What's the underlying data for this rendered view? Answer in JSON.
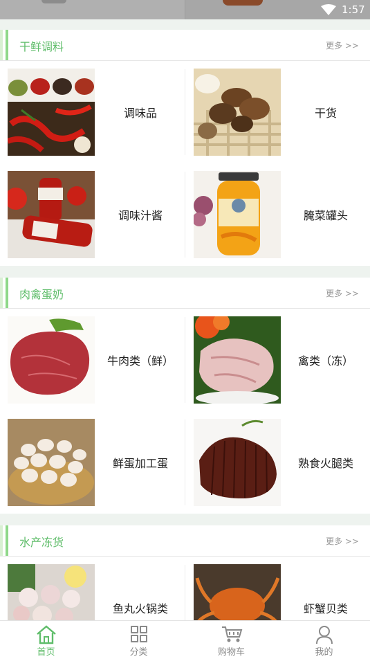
{
  "status": {
    "time": "1:57"
  },
  "sections": [
    {
      "title": "干鲜调料",
      "more": "更多 >>",
      "items": [
        {
          "label": "调味品"
        },
        {
          "label": "干货"
        },
        {
          "label": "调味汁酱"
        },
        {
          "label": "腌菜罐头"
        }
      ]
    },
    {
      "title": "肉禽蛋奶",
      "more": "更多 >>",
      "items": [
        {
          "label": "牛肉类（鲜）"
        },
        {
          "label": "禽类（冻）"
        },
        {
          "label": "鲜蛋加工蛋"
        },
        {
          "label": "熟食火腿类"
        }
      ]
    },
    {
      "title": "水产冻货",
      "more": "更多 >>",
      "items": [
        {
          "label": "鱼丸火锅类"
        },
        {
          "label": "虾蟹贝类"
        }
      ]
    }
  ],
  "tabs": [
    {
      "label": "首页",
      "icon": "home-icon",
      "active": true
    },
    {
      "label": "分类",
      "icon": "grid-icon"
    },
    {
      "label": "购物车",
      "icon": "cart-icon"
    },
    {
      "label": "我的",
      "icon": "user-icon"
    }
  ],
  "colors": {
    "accent": "#5fbd6a",
    "background": "#eef3ef"
  }
}
